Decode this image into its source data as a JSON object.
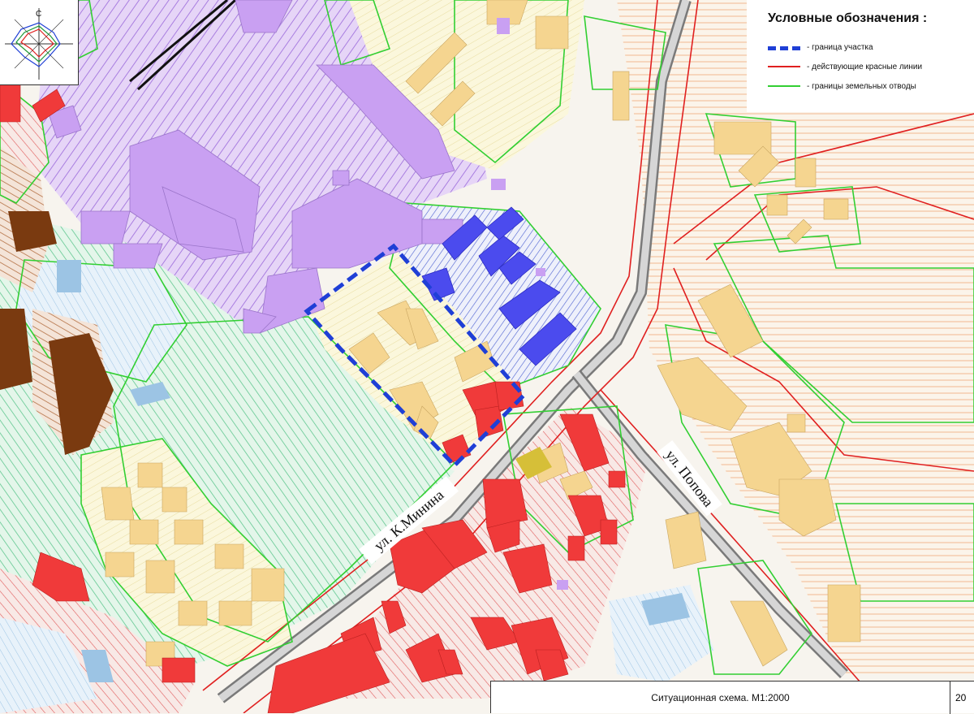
{
  "legend": {
    "title": "Условные обозначения :",
    "items": [
      {
        "label": "- граница участка",
        "color": "#1f3fd6"
      },
      {
        "label": "- действующие красные линии",
        "color": "#e02020"
      },
      {
        "label": "- границы земельных отводы",
        "color": "#32cf32"
      }
    ]
  },
  "streets": {
    "minina": "ул. К.Минина",
    "popova": "ул. Попова"
  },
  "wind_rose": {
    "north_label": "С"
  },
  "title_block": {
    "caption": "Ситуационная схема. М1:2000",
    "sheet_number": "20"
  },
  "colors": {
    "plot_boundary": "#1f3fd6",
    "red_lines": "#e02020",
    "land_allotment": "#32cf32",
    "industrial": "#c9a0f2",
    "residential": "#f5d590",
    "public": "#f03a3a",
    "site_buildings": "#4b4bee",
    "brown": "#7a3a10"
  }
}
